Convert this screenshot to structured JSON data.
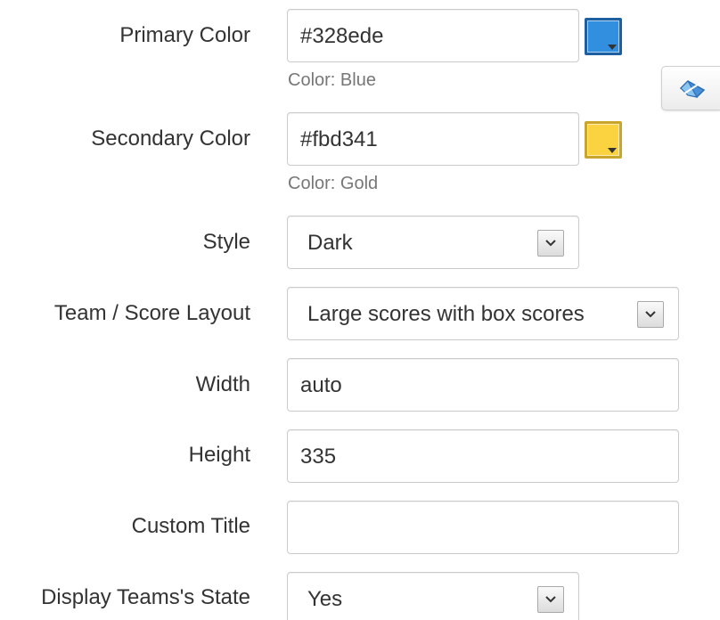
{
  "form": {
    "primary_color": {
      "label": "Primary Color",
      "value": "#328ede",
      "helper": "Color: Blue",
      "swatch_color": "#328ede",
      "swatch_border": "#1d5fa0"
    },
    "secondary_color": {
      "label": "Secondary Color",
      "value": "#fbd341",
      "helper": "Color: Gold",
      "swatch_color": "#fbd341",
      "swatch_border": "#c9a52c"
    },
    "style": {
      "label": "Style",
      "selected": "Dark"
    },
    "team_score_layout": {
      "label": "Team / Score Layout",
      "selected": "Large scores with box scores"
    },
    "width": {
      "label": "Width",
      "value": "auto"
    },
    "height": {
      "label": "Height",
      "value": "335"
    },
    "custom_title": {
      "label": "Custom Title",
      "value": ""
    },
    "display_team_state": {
      "label": "Display Teams's State",
      "selected": "Yes"
    }
  },
  "side_button": {
    "icon": "eraser-icon"
  }
}
